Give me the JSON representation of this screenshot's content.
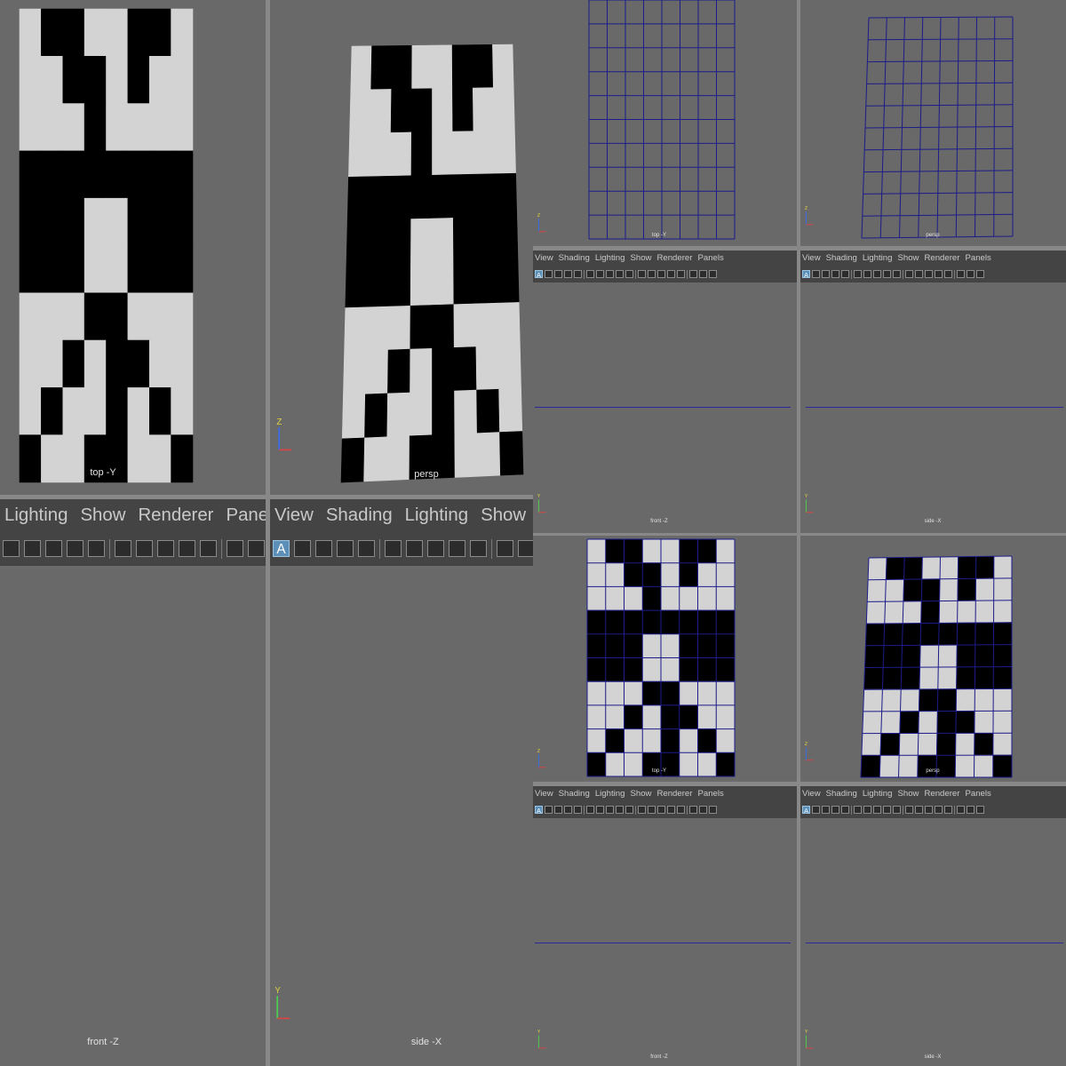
{
  "menu": {
    "view": "View",
    "shading": "Shading",
    "lighting": "Lighting",
    "show": "Show",
    "renderer": "Renderer",
    "panels": "Panels"
  },
  "labels": {
    "top": "top -Y",
    "persp": "persp",
    "front": "front -Z",
    "side": "side -X"
  },
  "icon_letter": "A",
  "axis": {
    "z": "Z",
    "y": "Y",
    "x": "X"
  },
  "colors": {
    "viewport_bg": "#696969",
    "toolbar_bg": "#444444",
    "menu_text": "#c9c9c9",
    "checker_dark": "#000000",
    "checker_light": "#d3d3d3",
    "wire": "#1c1c8a",
    "selected_icon": "#5b8fb8"
  },
  "pattern": [
    "10011001",
    "11001011",
    "11101111",
    "00000000",
    "00011000",
    "00011000",
    "11100111",
    "11010011",
    "10110101",
    "01100110"
  ]
}
